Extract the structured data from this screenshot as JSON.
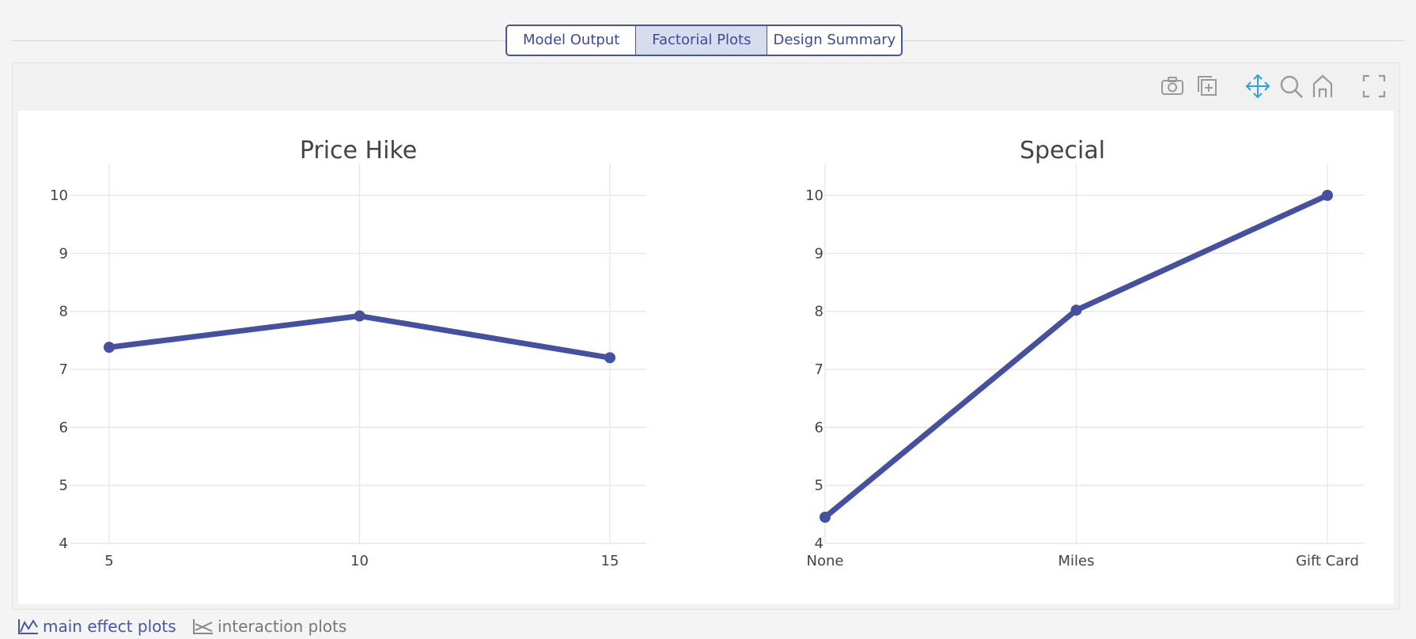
{
  "tabs": [
    {
      "label": "Model Output",
      "active": false
    },
    {
      "label": "Factorial Plots",
      "active": true
    },
    {
      "label": "Design Summary",
      "active": false
    }
  ],
  "toolbar": {
    "icons": [
      "camera-icon",
      "copy-icon",
      "pan-icon",
      "zoom-icon",
      "home-icon",
      "fullscreen-icon"
    ],
    "active_color": "#2aa3d8",
    "icon_color": "#9a9a9a"
  },
  "colors": {
    "line": "#4550a0",
    "grid": "#e8e8e8",
    "text": "#444444"
  },
  "chart_data": [
    {
      "type": "line",
      "title": "Price Hike",
      "categories": [
        "5",
        "10",
        "15"
      ],
      "values": [
        7.38,
        7.92,
        7.2
      ],
      "ylim": [
        4,
        10
      ],
      "yticks": [
        "4",
        "5",
        "6",
        "7",
        "8",
        "9",
        "10"
      ],
      "grid": true
    },
    {
      "type": "line",
      "title": "Special",
      "categories": [
        "None",
        "Miles",
        "Gift Card"
      ],
      "values": [
        4.45,
        8.02,
        10.0
      ],
      "ylim": [
        4,
        10
      ],
      "yticks": [
        "4",
        "5",
        "6",
        "7",
        "8",
        "9",
        "10"
      ],
      "grid": true
    }
  ],
  "bottom_links": [
    {
      "label": "main effect plots",
      "icon": "main-effect-icon"
    },
    {
      "label": "interaction plots",
      "icon": "interaction-icon"
    }
  ]
}
